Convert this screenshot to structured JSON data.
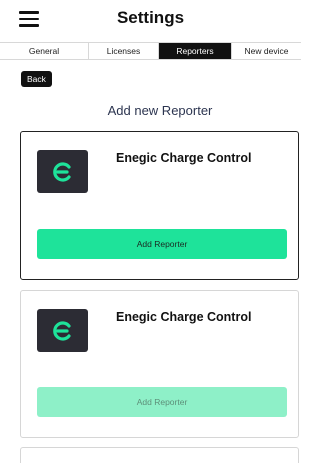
{
  "header": {
    "title": "Settings",
    "menu_icon": "hamburger-menu-icon"
  },
  "tabs": [
    {
      "label": "General",
      "active": false
    },
    {
      "label": "Licenses",
      "active": false
    },
    {
      "label": "Reporters",
      "active": true
    },
    {
      "label": "New device",
      "active": false
    }
  ],
  "back_label": "Back",
  "section_title": "Add new Reporter",
  "reporters": [
    {
      "name": "Enegic Charge Control",
      "logo_icon": "enegic-logo-icon",
      "button_label": "Add Reporter",
      "button_enabled": true
    },
    {
      "name": "Enegic Charge Control",
      "logo_icon": "enegic-logo-icon",
      "button_label": "Add Reporter",
      "button_enabled": false
    }
  ],
  "colors": {
    "accent": "#1ee39a",
    "accent_disabled": "#8ef0c8",
    "logo_bg": "#2c2c34",
    "tab_active_bg": "#111111"
  }
}
